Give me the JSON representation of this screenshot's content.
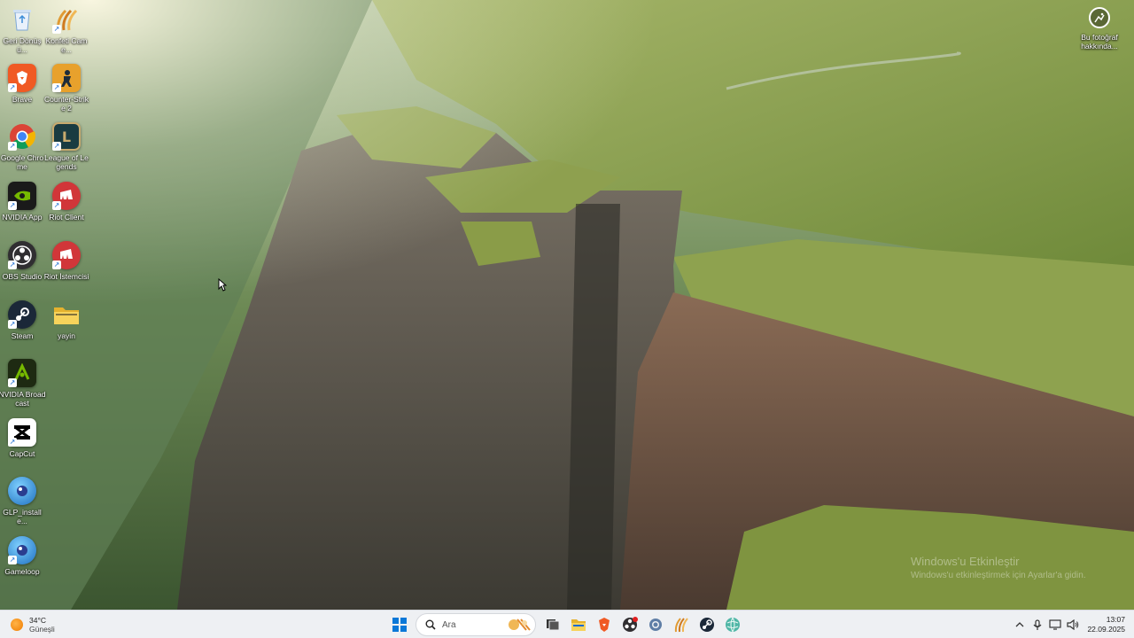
{
  "desktop": {
    "icons": [
      {
        "name": "recycle-bin-icon",
        "label": "Geri Dönüşü...",
        "color": "#3d8ed8"
      },
      {
        "name": "konfeti-icon",
        "label": "Konfeti Came...",
        "color": "#d98d2a"
      },
      {
        "name": "brave-icon",
        "label": "Brave",
        "color": "#f05a24"
      },
      {
        "name": "counter-strike-icon",
        "label": "Counter-Strike 2",
        "color": "#e8a12c"
      },
      {
        "name": "chrome-icon",
        "label": "Google Chrome",
        "color": "#4285f4"
      },
      {
        "name": "league-of-legends-icon",
        "label": "League of Legends",
        "color": "#1a3b41"
      },
      {
        "name": "nvidia-app-icon",
        "label": "NVIDIA App",
        "color": "#76b900"
      },
      {
        "name": "riot-client-icon",
        "label": "Riot Client",
        "color": "#d13639"
      },
      {
        "name": "obs-studio-icon",
        "label": "OBS Studio",
        "color": "#302e31"
      },
      {
        "name": "riot-istemcisi-icon",
        "label": "Riot İstemcisi",
        "color": "#d13639"
      },
      {
        "name": "steam-icon",
        "label": "Steam",
        "color": "#1b2838"
      },
      {
        "name": "folder-icon",
        "label": "yayin",
        "color": "#f2c94c"
      },
      {
        "name": "nvidia-broadcast-icon",
        "label": "NVIDIA Broadcast",
        "color": "#2c3a1a"
      },
      {
        "name": "capcut-icon",
        "label": "CapCut",
        "color": "#000000"
      },
      {
        "name": "glp-installer-icon",
        "label": "GLP_installe...",
        "color": "#3aa0e0"
      },
      {
        "name": "gameloop-icon",
        "label": "Gameloop",
        "color": "#2f7fd8"
      }
    ],
    "about_photo_label": "Bu fotoğraf hakkında...",
    "watermark": {
      "line1": "Windows'u Etkinleştir",
      "line2": "Windows'u etkinleştirmek için Ayarlar'a gidin."
    }
  },
  "taskbar": {
    "weather": {
      "temp": "34°C",
      "condition": "Güneşli"
    },
    "search_placeholder": "Ara",
    "apps": [
      {
        "name": "task-view-icon"
      },
      {
        "name": "file-explorer-icon"
      },
      {
        "name": "brave-taskbar-icon"
      },
      {
        "name": "obs-taskbar-icon"
      },
      {
        "name": "settings-icon"
      },
      {
        "name": "konfeti-taskbar-icon"
      },
      {
        "name": "steam-taskbar-icon"
      },
      {
        "name": "globe-app-icon"
      }
    ],
    "clock": {
      "time": "13:07",
      "date": "22.09.2025"
    }
  },
  "colors": {
    "taskbar_bg": "#eef0f3",
    "accent": "#0a78d8"
  }
}
